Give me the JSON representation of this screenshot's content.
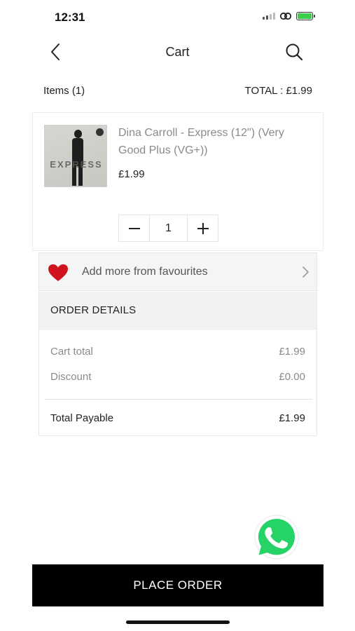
{
  "status_bar": {
    "time": "12:31"
  },
  "header": {
    "title": "Cart",
    "back_icon": "chevron-left-icon",
    "search_icon": "search-icon"
  },
  "summary": {
    "items_label": "Items (1)",
    "total_label": "TOTAL :  £1.99"
  },
  "product": {
    "title": "Dina Carroll - Express (12\") (Very Good Plus (VG+))",
    "price": "£1.99",
    "thumbnail_text": "EXPRESS",
    "quantity": "1"
  },
  "favourites": {
    "label": "Add more from favourites",
    "heart_color": "#d0141e"
  },
  "order_details": {
    "heading": "ORDER DETAILS",
    "cart_total_label": "Cart total",
    "cart_total_value": "£1.99",
    "discount_label": "Discount",
    "discount_value": "£0.00",
    "total_payable_label": "Total Payable",
    "total_payable_value": "£1.99"
  },
  "actions": {
    "place_order_label": "PLACE ORDER"
  },
  "colors": {
    "primary_button": "#000000",
    "whatsapp_green": "#25d366",
    "battery_green": "#3ccf4e"
  }
}
